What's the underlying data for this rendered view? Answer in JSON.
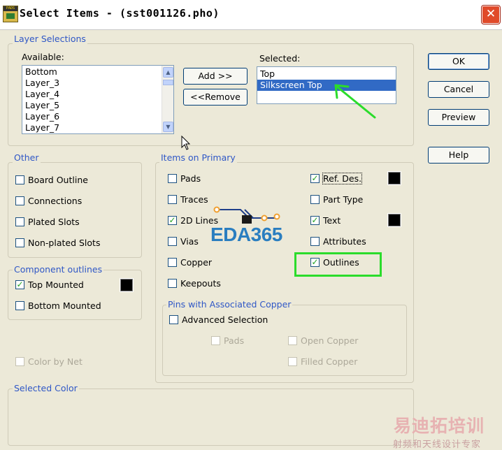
{
  "window": {
    "title": "Select Items - (sst001126.pho)",
    "close": "✕",
    "app_icon_text": "PADS"
  },
  "layer_selections": {
    "group_label": "Layer Selections",
    "available_label": "Available:",
    "available_items": [
      "Bottom",
      "Layer_3",
      "Layer_4",
      "Layer_5",
      "Layer_6",
      "Layer_7"
    ],
    "selected_label": "Selected:",
    "selected_items": [
      "Top",
      "Silkscreen Top"
    ],
    "add_button": "Add >>",
    "remove_button": "<<Remove"
  },
  "actions": {
    "ok": "OK",
    "cancel": "Cancel",
    "preview": "Preview",
    "help": "Help"
  },
  "other": {
    "group_label": "Other",
    "items": [
      {
        "label": "Board Outline",
        "checked": false
      },
      {
        "label": "Connections",
        "checked": false
      },
      {
        "label": "Plated Slots",
        "checked": false
      },
      {
        "label": "Non-plated Slots",
        "checked": false
      }
    ]
  },
  "component_outlines": {
    "group_label": "Component outlines",
    "items": [
      {
        "label": "Top Mounted",
        "checked": true
      },
      {
        "label": "Bottom Mounted",
        "checked": false
      }
    ]
  },
  "color_by_net": {
    "label": "Color by Net",
    "checked": false,
    "disabled": true
  },
  "items_on_primary": {
    "group_label": "Items on Primary",
    "left": [
      {
        "label": "Pads",
        "checked": false
      },
      {
        "label": "Traces",
        "checked": false
      },
      {
        "label": "2D Lines",
        "checked": true
      },
      {
        "label": "Vias",
        "checked": false
      },
      {
        "label": "Copper",
        "checked": false
      },
      {
        "label": "Keepouts",
        "checked": false
      }
    ],
    "right": [
      {
        "label": "Ref. Des.",
        "checked": true
      },
      {
        "label": "Part Type",
        "checked": false
      },
      {
        "label": "Text",
        "checked": true
      },
      {
        "label": "Attributes",
        "checked": false
      },
      {
        "label": "Outlines",
        "checked": true
      }
    ]
  },
  "pins_copper": {
    "group_label": "Pins with Associated Copper",
    "advanced": {
      "label": "Advanced Selection",
      "checked": false
    },
    "pads": {
      "label": "Pads",
      "checked": false
    },
    "open_copper": {
      "label": "Open Copper",
      "checked": false
    },
    "filled_copper": {
      "label": "Filled Copper",
      "checked": false
    }
  },
  "selected_color": {
    "group_label": "Selected Color"
  },
  "watermark": {
    "logo": "EDA365",
    "cn_title": "易迪拓培训",
    "cn_sub": "射频和天线设计专家"
  },
  "colors": {
    "accent": "#2f57c6",
    "highlight": "#2bdc2b",
    "selection": "#316ac5",
    "check": "#21a121"
  }
}
